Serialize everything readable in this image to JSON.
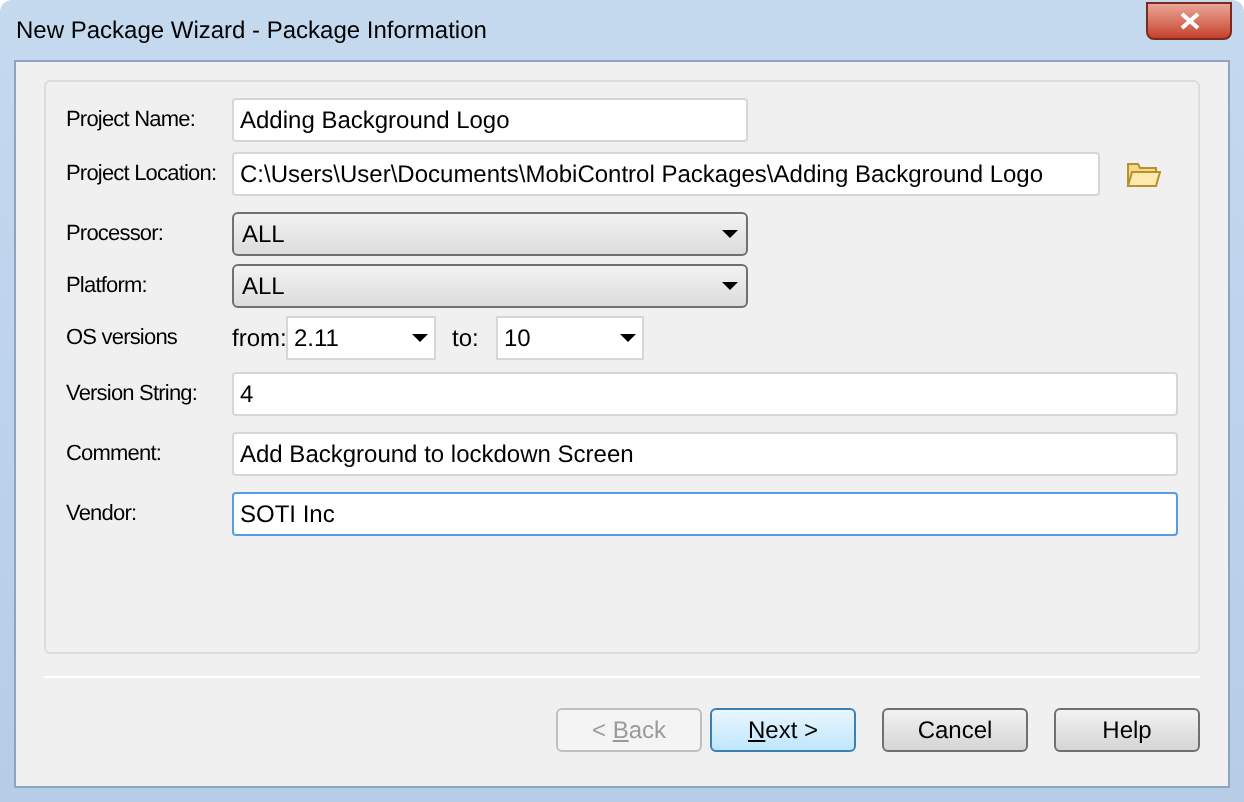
{
  "window": {
    "title": "New Package Wizard - Package Information"
  },
  "fields": [
    {
      "kind": "text",
      "label": "Project Name:",
      "value": "Adding Background Logo",
      "focused": false
    },
    {
      "kind": "path",
      "label": "Project Location:",
      "value": "C:\\Users\\User\\Documents\\MobiControl Packages\\Adding Background Logo",
      "focused": false
    },
    {
      "kind": "select",
      "label": "Processor:",
      "value": "ALL"
    },
    {
      "kind": "select",
      "label": "Platform:",
      "value": "ALL"
    },
    {
      "kind": "range",
      "label": "OS versions",
      "from_label": "from:",
      "from_value": "2.11",
      "to_label": "to:",
      "to_value": "10"
    },
    {
      "kind": "wide",
      "label": "Version String:",
      "value": "4",
      "focused": false
    },
    {
      "kind": "wide",
      "label": "Comment:",
      "value": "Add Background to lockdown Screen",
      "focused": false
    },
    {
      "kind": "wide",
      "label": "Vendor:",
      "value": "SOTI Inc",
      "focused": true
    }
  ],
  "buttons": [
    {
      "label_parts": [
        {
          "text": "< ",
          "mnemonic": false
        },
        {
          "text": "B",
          "mnemonic": true
        },
        {
          "text": "ack",
          "mnemonic": false
        }
      ],
      "disabled": true,
      "default": false
    },
    {
      "label_parts": [
        {
          "text": "N",
          "mnemonic": true
        },
        {
          "text": "ext >",
          "mnemonic": false
        }
      ],
      "disabled": false,
      "default": true
    },
    {
      "label_parts": [
        {
          "text": "Cancel",
          "mnemonic": false
        }
      ],
      "disabled": false,
      "default": false
    },
    {
      "label_parts": [
        {
          "text": "Help",
          "mnemonic": false
        }
      ],
      "disabled": false,
      "default": false
    }
  ]
}
